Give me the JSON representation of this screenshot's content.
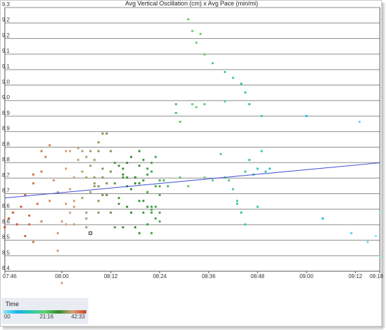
{
  "chart_data": {
    "type": "scatter",
    "title": "Avg Vertical Oscillation (cm) x Avg Pace (min/mi)",
    "x_unit": "time of day",
    "xlim": [
      "07:46",
      "09:18"
    ],
    "x_ticks": [
      "07:46",
      "08:00",
      "08:12",
      "08:24",
      "08:36",
      "08:48",
      "09:00",
      "09:12",
      "09:18"
    ],
    "ylim": [
      8.4,
      9.3
    ],
    "y_ticks": [
      "8.4",
      "8.5",
      "8.5",
      "8.6",
      "8.6",
      "8.7",
      "8.7",
      "8.8",
      "8.8",
      "8.9",
      "8.9",
      "9.0",
      "9.0",
      "9.1",
      "9.1",
      "9.2",
      "9.2",
      "9.3"
    ],
    "grid": true,
    "trendline": {
      "color": "#3a4ad6",
      "start": [
        "07:46",
        8.65
      ],
      "end": [
        "09:18",
        8.77
      ]
    },
    "color_legend": {
      "title": "Time",
      "labels": [
        "00",
        "21:16",
        "42:33"
      ],
      "gradient": [
        "#86e9f4",
        "#19b4ea",
        "#2fc8b0",
        "#5fd36b",
        "#2f8a2f",
        "#d9a07a",
        "#c8421f"
      ]
    },
    "points": [
      [
        "07:46",
        8.55
      ],
      [
        "07:47",
        8.58
      ],
      [
        "07:48",
        8.6
      ],
      [
        "07:49",
        8.56
      ],
      [
        "07:50",
        8.62
      ],
      [
        "07:51",
        8.52
      ],
      [
        "07:51",
        8.66
      ],
      [
        "07:52",
        8.59
      ],
      [
        "07:52",
        8.56
      ],
      [
        "07:53",
        8.7
      ],
      [
        "07:53",
        8.73
      ],
      [
        "07:54",
        8.63
      ],
      [
        "07:55",
        8.57
      ],
      [
        "07:55",
        8.81
      ],
      [
        "07:56",
        8.79
      ],
      [
        "07:57",
        8.64
      ],
      [
        "07:58",
        8.71
      ],
      [
        "07:59",
        8.53
      ],
      [
        "07:59",
        8.47
      ],
      [
        "08:00",
        8.36
      ],
      [
        "07:59",
        8.67
      ],
      [
        "08:01",
        8.56
      ],
      [
        "08:02",
        8.6
      ],
      [
        "08:03",
        8.64
      ],
      [
        "07:53",
        8.5
      ],
      [
        "07:55",
        8.74
      ],
      [
        "07:57",
        8.83
      ],
      [
        "08:00",
        8.57
      ],
      [
        "08:03",
        8.62
      ],
      [
        "08:06",
        8.6
      ],
      [
        "08:01",
        8.75
      ],
      [
        "08:02",
        8.68
      ],
      [
        "08:03",
        8.72
      ],
      [
        "08:04",
        8.78
      ],
      [
        "08:05",
        8.65
      ],
      [
        "08:05",
        8.74
      ],
      [
        "08:06",
        8.58
      ],
      [
        "08:06",
        8.72
      ],
      [
        "08:07",
        8.67
      ],
      [
        "08:08",
        8.7
      ],
      [
        "08:09",
        8.6
      ],
      [
        "08:10",
        8.66
      ],
      [
        "08:01",
        8.63
      ],
      [
        "08:01",
        8.81
      ],
      [
        "08:02",
        8.81
      ],
      [
        "08:04",
        8.82
      ],
      [
        "08:05",
        8.81
      ],
      [
        "08:06",
        8.79
      ],
      [
        "08:07",
        8.81
      ],
      [
        "08:08",
        8.78
      ],
      [
        "08:09",
        8.81
      ],
      [
        "08:10",
        8.75
      ],
      [
        "08:08",
        8.69
      ],
      [
        "08:09",
        8.64
      ],
      [
        "08:10",
        8.72
      ],
      [
        "08:11",
        8.66
      ],
      [
        "08:12",
        8.6
      ],
      [
        "08:12",
        8.74
      ],
      [
        "08:13",
        8.55
      ],
      [
        "08:14",
        8.65
      ],
      [
        "08:07",
        8.76
      ],
      [
        "08:08",
        8.72
      ],
      [
        "08:09",
        8.84
      ],
      [
        "08:10",
        8.87
      ],
      [
        "08:11",
        8.87
      ],
      [
        "08:09",
        8.69
      ],
      [
        "08:13",
        8.7
      ],
      [
        "08:14",
        8.63
      ],
      [
        "08:15",
        8.55
      ],
      [
        "08:15",
        8.72
      ],
      [
        "08:16",
        8.77
      ],
      [
        "08:16",
        8.62
      ],
      [
        "08:17",
        8.6
      ],
      [
        "08:17",
        8.68
      ],
      [
        "08:18",
        8.55
      ],
      [
        "08:18",
        8.72
      ],
      [
        "08:19",
        8.64
      ],
      [
        "08:19",
        8.53
      ],
      [
        "08:20",
        8.6
      ],
      [
        "08:20",
        8.71
      ],
      [
        "08:21",
        8.56
      ],
      [
        "08:21",
        8.67
      ],
      [
        "08:22",
        8.62
      ],
      [
        "08:22",
        8.53
      ],
      [
        "08:23",
        8.58
      ],
      [
        "08:23",
        8.69
      ],
      [
        "08:24",
        8.6
      ],
      [
        "08:24",
        8.66
      ],
      [
        "08:19",
        8.81
      ],
      [
        "08:17",
        8.79
      ],
      [
        "08:15",
        8.75
      ],
      [
        "08:13",
        8.77
      ],
      [
        "08:12",
        8.81
      ],
      [
        "08:15",
        8.73
      ],
      [
        "08:18",
        8.72
      ],
      [
        "08:21",
        8.75
      ],
      [
        "08:20",
        8.64
      ],
      [
        "08:21",
        8.62
      ],
      [
        "08:22",
        8.61
      ],
      [
        "08:23",
        8.62
      ],
      [
        "08:22",
        8.6
      ],
      [
        "08:24",
        8.57
      ],
      [
        "08:20",
        8.78
      ],
      [
        "08:21",
        8.73
      ],
      [
        "08:22",
        8.77
      ],
      [
        "08:23",
        8.79
      ],
      [
        "08:19",
        8.7
      ],
      [
        "08:24",
        8.69
      ],
      [
        "08:16",
        8.69
      ],
      [
        "08:18",
        8.7
      ],
      [
        "08:14",
        8.76
      ],
      [
        "08:16",
        8.72
      ],
      [
        "08:19",
        8.76
      ],
      [
        "08:22",
        8.74
      ],
      [
        "08:24",
        8.71
      ],
      [
        "08:25",
        8.71
      ],
      [
        "08:26",
        8.69
      ],
      [
        "08:29",
        8.72
      ],
      [
        "08:31",
        8.69
      ],
      [
        "08:35",
        8.72
      ],
      [
        "08:37",
        8.71
      ],
      [
        "08:40",
        8.72
      ],
      [
        "08:42",
        8.68
      ],
      [
        "08:43",
        8.64
      ],
      [
        "08:44",
        8.6
      ],
      [
        "08:45",
        8.74
      ],
      [
        "08:46",
        8.78
      ],
      [
        "08:47",
        8.73
      ],
      [
        "08:48",
        8.62
      ],
      [
        "08:48",
        8.75
      ],
      [
        "08:50",
        8.74
      ],
      [
        "08:51",
        8.75
      ],
      [
        "08:49",
        8.81
      ],
      [
        "08:45",
        8.56
      ],
      [
        "08:43",
        8.63
      ],
      [
        "08:41",
        8.71
      ],
      [
        "08:39",
        8.8
      ],
      [
        "08:28",
        8.97
      ],
      [
        "08:28",
        8.94
      ],
      [
        "08:29",
        8.91
      ],
      [
        "08:32",
        8.97
      ],
      [
        "08:33",
        8.96
      ],
      [
        "08:35",
        8.97
      ],
      [
        "08:40",
        8.98
      ],
      [
        "08:46",
        8.97
      ],
      [
        "08:49",
        8.93
      ],
      [
        "08:31",
        9.26
      ],
      [
        "08:32",
        9.22
      ],
      [
        "08:33",
        9.18
      ],
      [
        "08:34",
        9.21
      ],
      [
        "08:35",
        9.14
      ],
      [
        "08:37",
        9.11
      ],
      [
        "08:40",
        9.08
      ],
      [
        "08:42",
        9.06
      ],
      [
        "08:44",
        9.04
      ],
      [
        "08:45",
        9.01
      ],
      [
        "08:46",
        8.97
      ],
      [
        "09:00",
        8.93
      ],
      [
        "09:13",
        8.91
      ],
      [
        "09:15",
        8.5
      ],
      [
        "09:17",
        8.52
      ],
      [
        "09:18",
        8.45
      ],
      [
        "09:11",
        8.53
      ],
      [
        "09:04",
        8.58
      ],
      [
        "09:18",
        8.6
      ],
      [
        "08:03",
        8.56
      ],
      [
        "08:06",
        8.55
      ],
      [
        "08:11",
        8.7
      ]
    ],
    "highlighted_point": [
      "08:07",
      8.53
    ]
  }
}
